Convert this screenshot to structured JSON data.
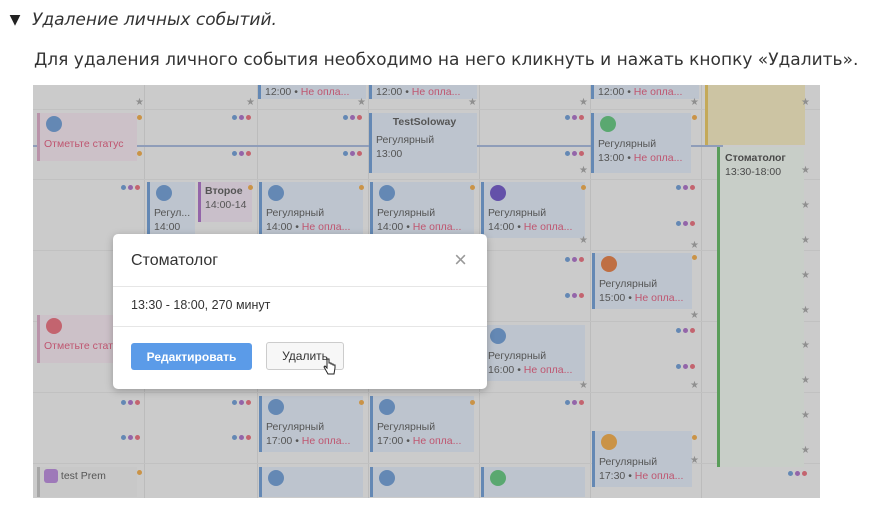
{
  "section": {
    "marker": "▼",
    "title": "Удаление личных событий."
  },
  "description": "Для удаления личного события необходимо на него кликнуть и нажать кнопку «Удалить».",
  "screenshot": {
    "events": {
      "top_times": [
        "12:00 • ",
        "12:00 • ",
        "12:00 • "
      ],
      "top_pay": [
        "Не опла...",
        "Не опла...",
        "Не опла..."
      ],
      "status_label": "Отметьте статус",
      "status_label_short": "Отметьте стат",
      "soloway_name": "TestSoloway",
      "regular": "Регулярный",
      "regular_short": "Регул...",
      "t1300": "13:00",
      "t1300pay": "13:00 • ",
      "vtoroe": "Второе",
      "vtoroe_time": "14:00-14",
      "t1400": "14:00 • ",
      "t1400short": "14:00",
      "t1500": "15:00 • ",
      "t1600": "16:00 • ",
      "t1700": "17:00 • ",
      "t1730": "17:30 • ",
      "pay": "Не опла...",
      "dentist_name": "Стоматолог",
      "dentist_time": "13:30-18:00",
      "test_prem": "test Prem"
    },
    "modal": {
      "title": "Стоматолог",
      "close": "×",
      "info": "13:30 - 18:00, 270 минут",
      "edit_button": "Редактировать",
      "delete_button": "Удалить"
    },
    "colors": {
      "edit_button": "#5b9be8",
      "unpaid_text": "#e0446b",
      "event_border": "#5b8fd0",
      "dentist_border": "#4cae4c"
    }
  }
}
